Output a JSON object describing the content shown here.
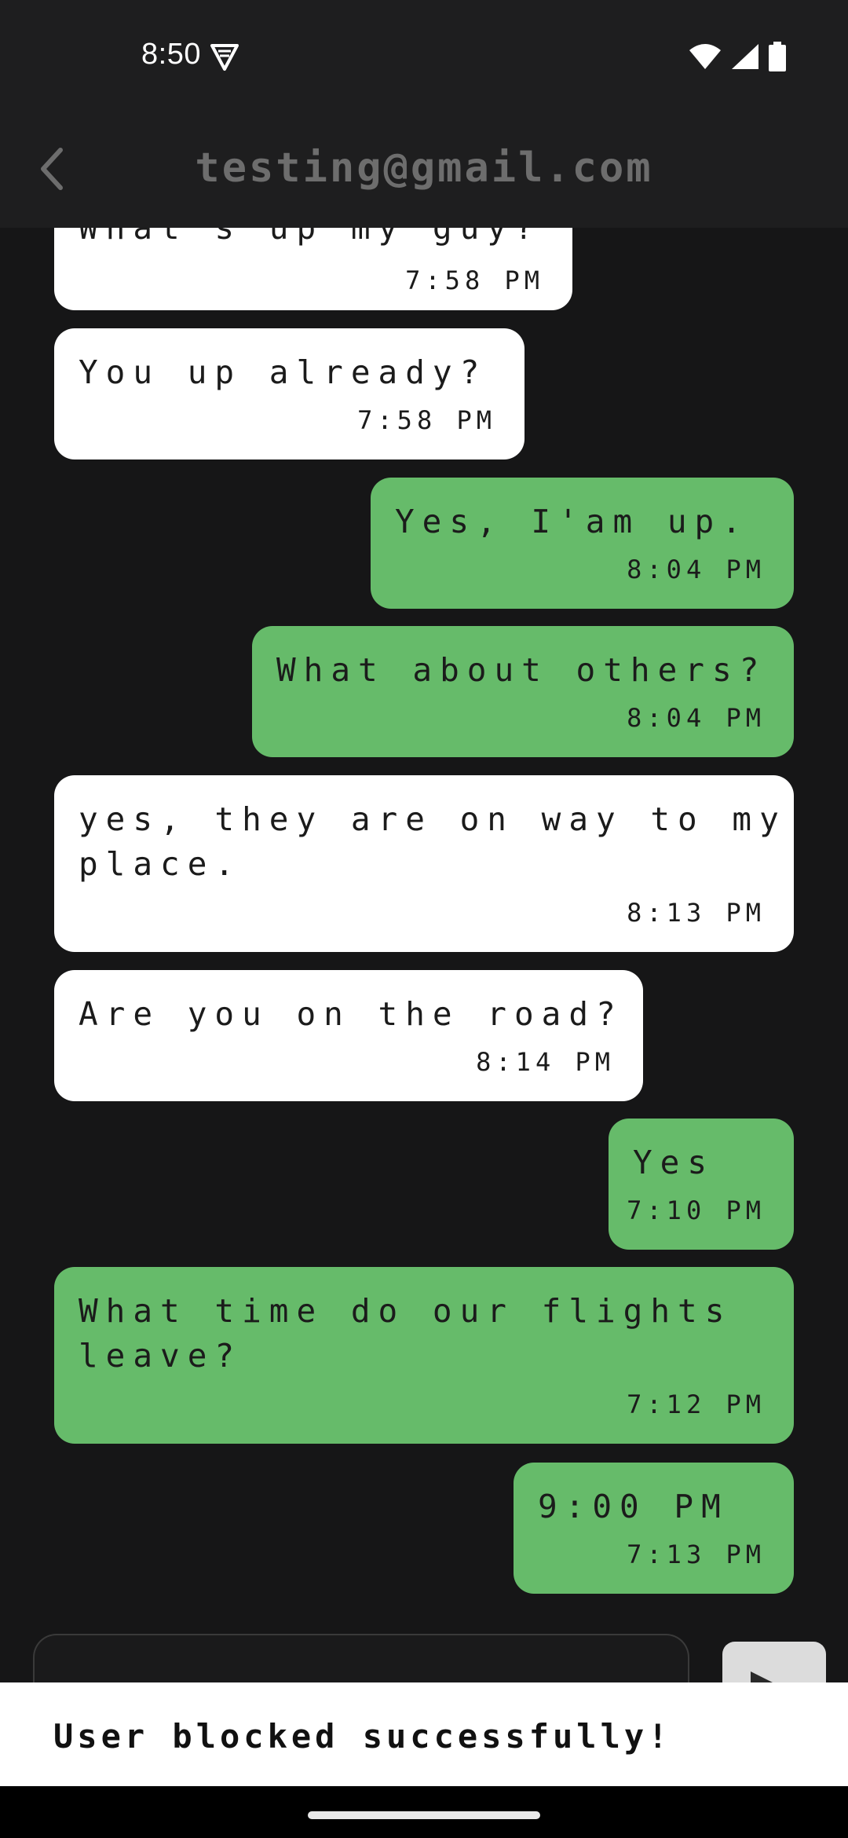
{
  "status_bar": {
    "time": "8:50",
    "icons": [
      "vpn-shield-icon",
      "wifi-icon",
      "cell-signal-icon",
      "battery-icon"
    ]
  },
  "app_bar": {
    "title": "testing@gmail.com",
    "back_icon": "chevron-left-icon"
  },
  "colors": {
    "incoming_bubble": "#ffffff",
    "outgoing_bubble": "#66bb6a",
    "background": "#161617",
    "app_bar": "#1e1e1f"
  },
  "messages": [
    {
      "direction": "in",
      "text": "What's up my guy?",
      "time": "7:58 PM"
    },
    {
      "direction": "in",
      "text": "You up already?",
      "time": "7:58 PM"
    },
    {
      "direction": "out",
      "text": "Yes, I'am up.",
      "time": "8:04 PM"
    },
    {
      "direction": "out",
      "text": "What about others?",
      "time": "8:04 PM"
    },
    {
      "direction": "in",
      "text": "yes, they are on way to my\nplace.",
      "time": "8:13 PM"
    },
    {
      "direction": "in",
      "text": "Are you on the road?",
      "time": "8:14 PM"
    },
    {
      "direction": "out",
      "text": "Yes",
      "time": "7:10 PM"
    },
    {
      "direction": "out",
      "text": "What time do our flights\nleave?",
      "time": "7:12 PM"
    },
    {
      "direction": "out",
      "text": "9:00 PM",
      "time": "7:13 PM"
    }
  ],
  "composer": {
    "placeholder": "",
    "send_icon": "send-arrow-icon"
  },
  "snackbar": {
    "text": "User blocked successfully!"
  }
}
